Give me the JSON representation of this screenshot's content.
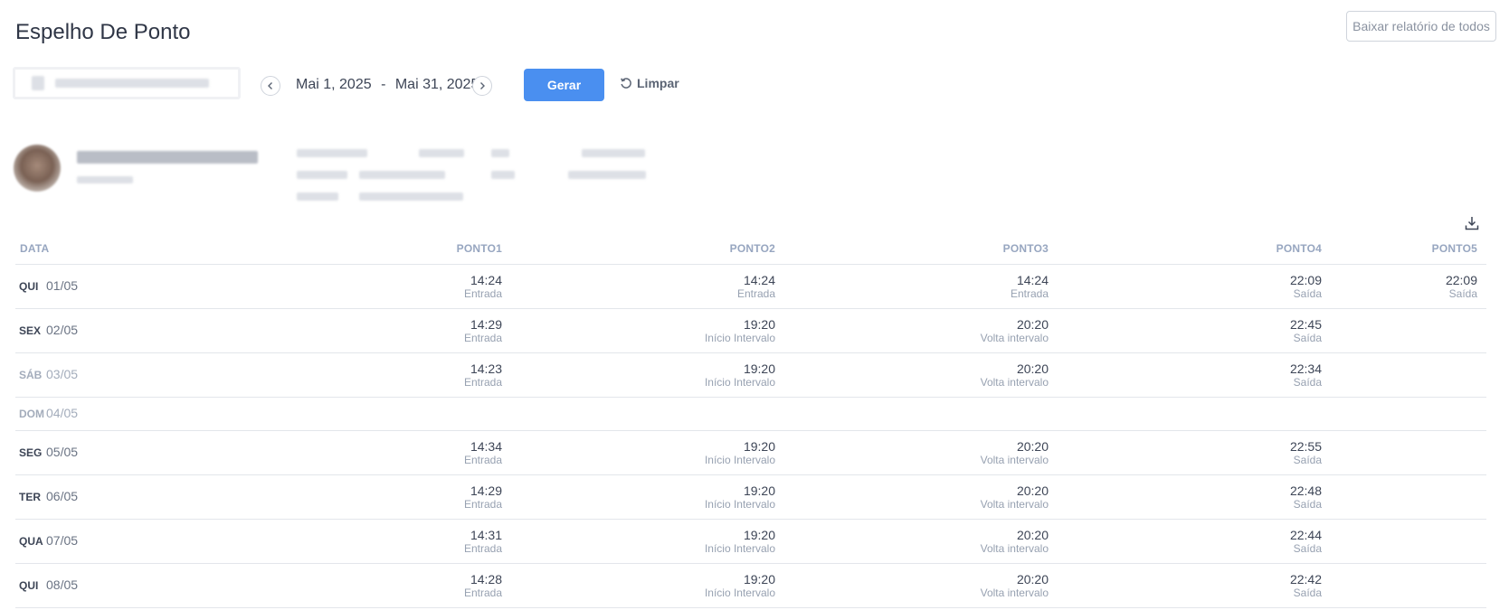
{
  "page": {
    "title": "Espelho De Ponto"
  },
  "actions": {
    "download_all": "Baixar relatório de todos",
    "generate": "Gerar",
    "clear": "Limpar"
  },
  "filters": {
    "date_start": "Mai 1, 2025",
    "date_sep": "-",
    "date_end": "Mai 31, 2025"
  },
  "colors": {
    "primary": "#4a8ff0",
    "header_text": "#97a6c0",
    "muted": "#a3acbb"
  },
  "table": {
    "headers": [
      "DATA",
      "PONTO1",
      "PONTO2",
      "PONTO3",
      "PONTO4",
      "PONTO5"
    ],
    "rows": [
      {
        "weekday": "QUI",
        "date": "01/05",
        "punches": [
          {
            "time": "14:24",
            "type": "Entrada"
          },
          {
            "time": "14:24",
            "type": "Entrada"
          },
          {
            "time": "14:24",
            "type": "Entrada"
          },
          {
            "time": "22:09",
            "type": "Saída"
          },
          {
            "time": "22:09",
            "type": "Saída"
          }
        ]
      },
      {
        "weekday": "SEX",
        "date": "02/05",
        "punches": [
          {
            "time": "14:29",
            "type": "Entrada"
          },
          {
            "time": "19:20",
            "type": "Início Intervalo"
          },
          {
            "time": "20:20",
            "type": "Volta intervalo"
          },
          {
            "time": "22:45",
            "type": "Saída"
          }
        ]
      },
      {
        "weekday": "SÁB",
        "date": "03/05",
        "muted": true,
        "punches": [
          {
            "time": "14:23",
            "type": "Entrada"
          },
          {
            "time": "19:20",
            "type": "Início Intervalo"
          },
          {
            "time": "20:20",
            "type": "Volta intervalo"
          },
          {
            "time": "22:34",
            "type": "Saída"
          }
        ]
      },
      {
        "weekday": "DOM",
        "date": "04/05",
        "muted": true,
        "punches": []
      },
      {
        "weekday": "SEG",
        "date": "05/05",
        "punches": [
          {
            "time": "14:34",
            "type": "Entrada"
          },
          {
            "time": "19:20",
            "type": "Início Intervalo"
          },
          {
            "time": "20:20",
            "type": "Volta intervalo"
          },
          {
            "time": "22:55",
            "type": "Saída"
          }
        ]
      },
      {
        "weekday": "TER",
        "date": "06/05",
        "punches": [
          {
            "time": "14:29",
            "type": "Entrada"
          },
          {
            "time": "19:20",
            "type": "Início Intervalo"
          },
          {
            "time": "20:20",
            "type": "Volta intervalo"
          },
          {
            "time": "22:48",
            "type": "Saída"
          }
        ]
      },
      {
        "weekday": "QUA",
        "date": "07/05",
        "punches": [
          {
            "time": "14:31",
            "type": "Entrada"
          },
          {
            "time": "19:20",
            "type": "Início Intervalo"
          },
          {
            "time": "20:20",
            "type": "Volta intervalo"
          },
          {
            "time": "22:44",
            "type": "Saída"
          }
        ]
      },
      {
        "weekday": "QUI",
        "date": "08/05",
        "punches": [
          {
            "time": "14:28",
            "type": "Entrada"
          },
          {
            "time": "19:20",
            "type": "Início Intervalo"
          },
          {
            "time": "20:20",
            "type": "Volta intervalo"
          },
          {
            "time": "22:42",
            "type": "Saída"
          }
        ]
      }
    ]
  }
}
